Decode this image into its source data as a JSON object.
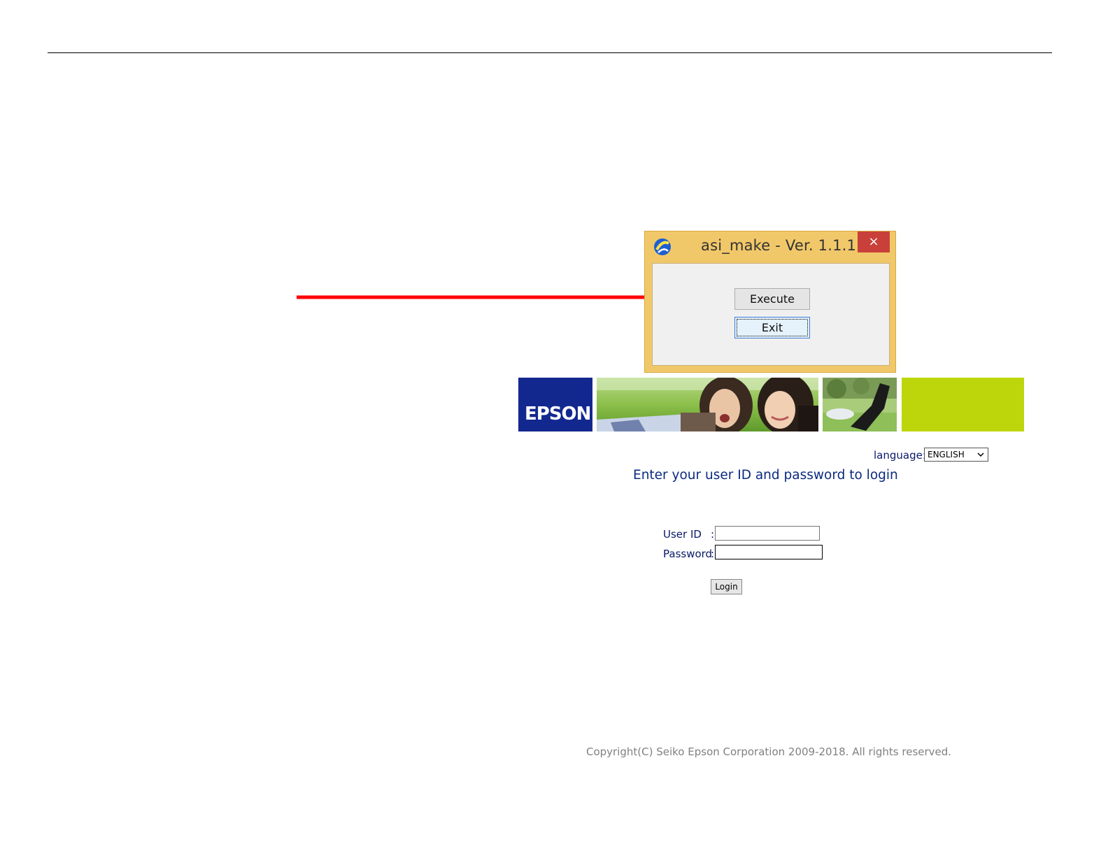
{
  "dialog": {
    "title": "asi_make - Ver. 1.1.1",
    "close_label": "×",
    "execute_label": "Execute",
    "exit_label": "Exit",
    "icon": "app-icon",
    "frame_color": "#f1c869",
    "close_color": "#c9403a"
  },
  "annotation": {
    "arrow_color": "#ff0000",
    "arrow_target": "execute-button"
  },
  "banner": {
    "logo_text": "EPSON",
    "logo_bg": "#13288f",
    "accent_green": "#bdd60b"
  },
  "login": {
    "language_label": "language:",
    "language_value": "ENGLISH",
    "heading": "Enter your user ID and password to login",
    "user_id_label": "User ID",
    "password_label": "Password",
    "colon": ":",
    "user_id_value": "",
    "password_value": "",
    "login_button": "Login"
  },
  "footer": {
    "copyright": "Copyright(C) Seiko Epson Corporation 2009-2018. All rights reserved."
  }
}
